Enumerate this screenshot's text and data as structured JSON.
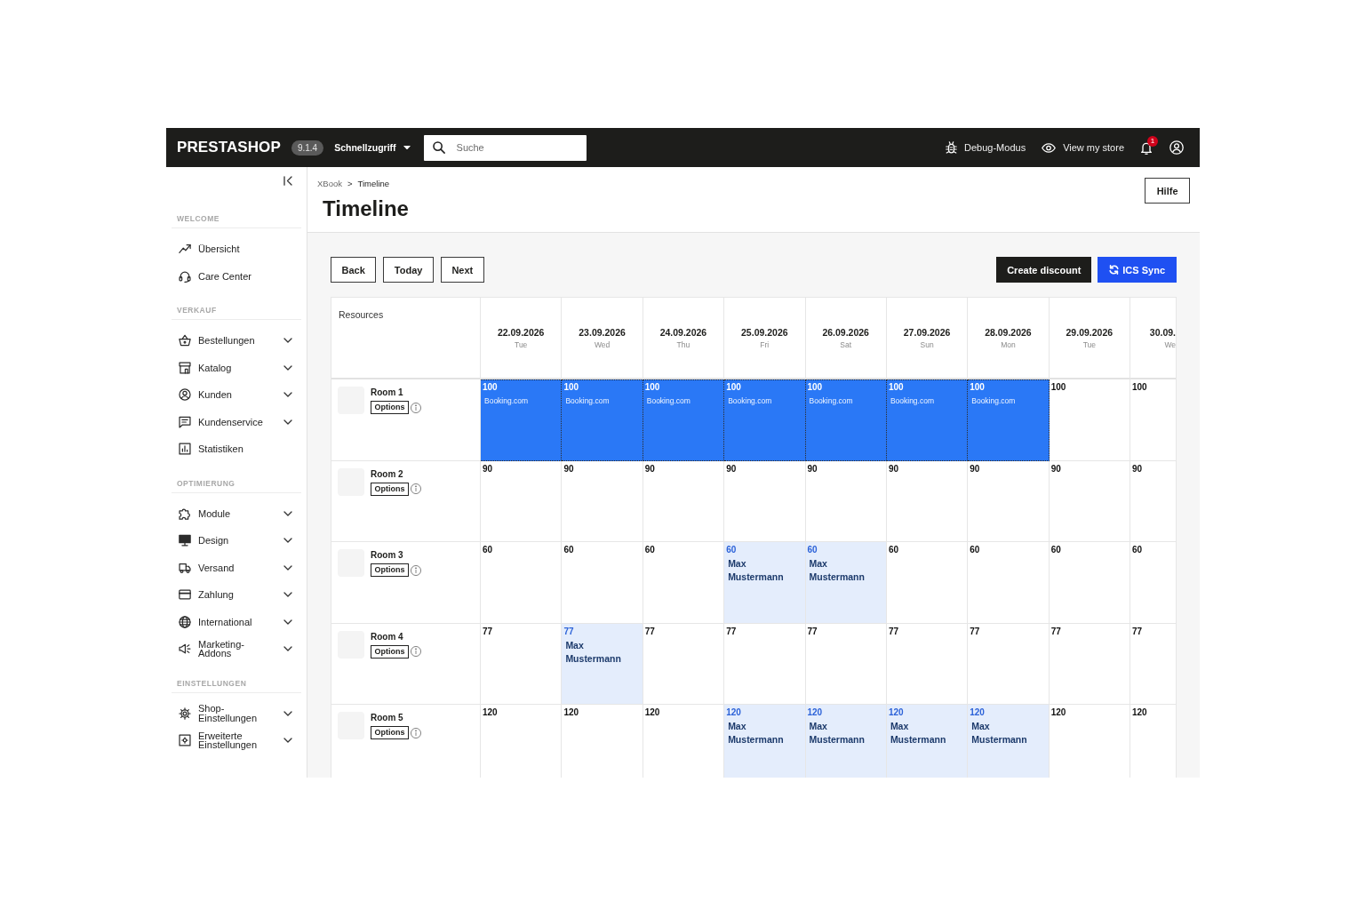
{
  "topbar": {
    "logo": "PRESTASHOP",
    "version": "9.1.4",
    "quick_access": "Schnellzugriff",
    "search": {
      "placeholder": "Suche"
    },
    "links": [
      {
        "label": "Debug-Modus"
      },
      {
        "label": "View my store"
      }
    ],
    "notifications": {
      "count": "1"
    }
  },
  "sidebar": {
    "sections": [
      {
        "label": "WELCOME",
        "items": [
          {
            "label": "Übersicht",
            "expandable": false
          },
          {
            "label": "Care Center",
            "expandable": false
          }
        ]
      },
      {
        "label": "VERKAUF",
        "items": [
          {
            "label": "Bestellungen",
            "expandable": true
          },
          {
            "label": "Katalog",
            "expandable": true
          },
          {
            "label": "Kunden",
            "expandable": true
          },
          {
            "label": "Kundenservice",
            "expandable": true
          },
          {
            "label": "Statistiken",
            "expandable": false
          }
        ]
      },
      {
        "label": "OPTIMIERUNG",
        "items": [
          {
            "label": "Module",
            "expandable": true
          },
          {
            "label": "Design",
            "expandable": true
          },
          {
            "label": "Versand",
            "expandable": true
          },
          {
            "label": "Zahlung",
            "expandable": true
          },
          {
            "label": "International",
            "expandable": true
          },
          {
            "label": "Marketing-Addons",
            "expandable": true
          }
        ]
      },
      {
        "label": "EINSTELLUNGEN",
        "items": [
          {
            "label": "Shop-Einstellungen",
            "expandable": true
          },
          {
            "label": "Erweiterte Einstellungen",
            "expandable": true
          }
        ]
      }
    ]
  },
  "header": {
    "breadcrumb": [
      "XBook",
      "Timeline"
    ],
    "breadcrumb_separator": ">",
    "title": "Timeline",
    "help_button": "Hilfe"
  },
  "toolbar": {
    "nav_buttons": [
      "Back",
      "Today",
      "Next"
    ],
    "actions": [
      {
        "kind": "dark",
        "label": "Create discount"
      },
      {
        "kind": "primary",
        "label": "ICS Sync"
      }
    ]
  },
  "timeline": {
    "resources_label": "Resources",
    "days": [
      {
        "date": "22.09.2026",
        "weekday": "Tue"
      },
      {
        "date": "23.09.2026",
        "weekday": "Wed"
      },
      {
        "date": "24.09.2026",
        "weekday": "Thu"
      },
      {
        "date": "25.09.2026",
        "weekday": "Fri"
      },
      {
        "date": "26.09.2026",
        "weekday": "Sat"
      },
      {
        "date": "27.09.2026",
        "weekday": "Sun"
      },
      {
        "date": "28.09.2026",
        "weekday": "Mon"
      },
      {
        "date": "29.09.2026",
        "weekday": "Tue"
      },
      {
        "date": "30.09.",
        "weekday": "We"
      }
    ],
    "rooms": [
      {
        "name": "Room 1",
        "options": "Options",
        "cells": [
          {
            "kind": "ota",
            "value": "100",
            "label": "Booking.com"
          },
          {
            "kind": "ota",
            "value": "100",
            "label": "Booking.com"
          },
          {
            "kind": "ota",
            "value": "100",
            "label": "Booking.com"
          },
          {
            "kind": "ota",
            "value": "100",
            "label": "Booking.com"
          },
          {
            "kind": "ota",
            "value": "100",
            "label": "Booking.com"
          },
          {
            "kind": "ota",
            "value": "100",
            "label": "Booking.com"
          },
          {
            "kind": "ota",
            "value": "100",
            "label": "Booking.com"
          },
          {
            "kind": "free",
            "value": "100"
          },
          {
            "kind": "free",
            "value": "100"
          }
        ]
      },
      {
        "name": "Room 2",
        "options": "Options",
        "cells": [
          {
            "kind": "free",
            "value": "90"
          },
          {
            "kind": "free",
            "value": "90"
          },
          {
            "kind": "free",
            "value": "90"
          },
          {
            "kind": "free",
            "value": "90"
          },
          {
            "kind": "free",
            "value": "90"
          },
          {
            "kind": "free",
            "value": "90"
          },
          {
            "kind": "free",
            "value": "90"
          },
          {
            "kind": "free",
            "value": "90"
          },
          {
            "kind": "free",
            "value": "90"
          }
        ]
      },
      {
        "name": "Room 3",
        "options": "Options",
        "cells": [
          {
            "kind": "free",
            "value": "60"
          },
          {
            "kind": "free",
            "value": "60"
          },
          {
            "kind": "free",
            "value": "60"
          },
          {
            "kind": "guest",
            "value": "60",
            "label": "Max Mustermann"
          },
          {
            "kind": "guest",
            "value": "60",
            "label": "Max Mustermann"
          },
          {
            "kind": "free",
            "value": "60"
          },
          {
            "kind": "free",
            "value": "60"
          },
          {
            "kind": "free",
            "value": "60"
          },
          {
            "kind": "free",
            "value": "60"
          }
        ]
      },
      {
        "name": "Room 4",
        "options": "Options",
        "cells": [
          {
            "kind": "free",
            "value": "77"
          },
          {
            "kind": "guest",
            "value": "77",
            "label": "Max Mustermann"
          },
          {
            "kind": "free",
            "value": "77"
          },
          {
            "kind": "free",
            "value": "77"
          },
          {
            "kind": "free",
            "value": "77"
          },
          {
            "kind": "free",
            "value": "77"
          },
          {
            "kind": "free",
            "value": "77"
          },
          {
            "kind": "free",
            "value": "77"
          },
          {
            "kind": "free",
            "value": "77"
          }
        ]
      },
      {
        "name": "Room 5",
        "options": "Options",
        "cells": [
          {
            "kind": "free",
            "value": "120"
          },
          {
            "kind": "free",
            "value": "120"
          },
          {
            "kind": "free",
            "value": "120"
          },
          {
            "kind": "guest",
            "value": "120",
            "label": "Max Mustermann"
          },
          {
            "kind": "guest",
            "value": "120",
            "label": "Max Mustermann"
          },
          {
            "kind": "guest",
            "value": "120",
            "label": "Max Mustermann"
          },
          {
            "kind": "guest",
            "value": "120",
            "label": "Max Mustermann"
          },
          {
            "kind": "free",
            "value": "120"
          },
          {
            "kind": "free",
            "value": "120"
          }
        ]
      }
    ]
  }
}
